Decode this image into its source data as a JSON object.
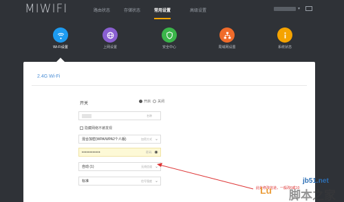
{
  "header": {
    "logo": "MIWIFI",
    "nav": [
      "路由状态",
      "存储状态",
      "常用设置",
      "高级设置"
    ],
    "active_nav": 2
  },
  "icons": [
    {
      "label": "Wi-Fi设置",
      "color": "#1d9bf0",
      "icon": "wifi-icon"
    },
    {
      "label": "上网设置",
      "color": "#8a5fd1",
      "icon": "globe-icon"
    },
    {
      "label": "安全中心",
      "color": "#3bb54a",
      "icon": "shield-icon"
    },
    {
      "label": "局域网设置",
      "color": "#f06b2a",
      "icon": "network-icon"
    },
    {
      "label": "系统状态",
      "color": "#f5a300",
      "icon": "info-icon"
    }
  ],
  "panel": {
    "title": "2.4G Wi-Fi",
    "switch_label": "开关",
    "on_label": "开启",
    "off_label": "关闭",
    "ssid_hint": "名称",
    "hide_label": "隐藏网络不被发现",
    "encryption_value": "混合加密(WPA/WPA2个人版)",
    "encryption_hint": "加密方式",
    "password_value": "••••••••••••",
    "password_hint": "密码",
    "channel_value": "自动 (1)",
    "channel_hint": "无线信道",
    "strength_value": "标准",
    "strength_hint": "信号强度"
  },
  "annotation": "此处修改信道，一般改6或10",
  "watermark": {
    "url": "jb51.net",
    "brand": "Lu",
    "site": "脚本之家"
  }
}
